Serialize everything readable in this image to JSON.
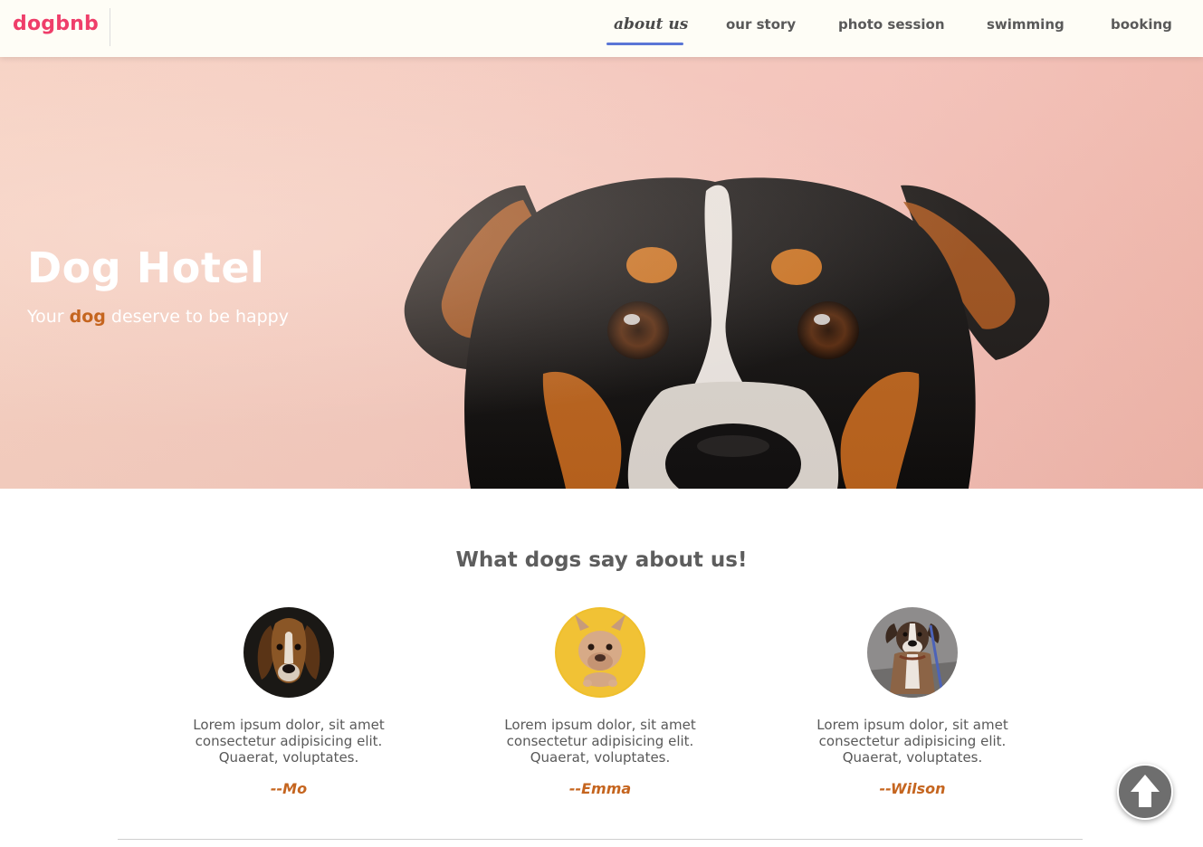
{
  "header": {
    "logo": "dogbnb",
    "nav": [
      {
        "label": "about us",
        "active": true
      },
      {
        "label": "our story",
        "active": false
      },
      {
        "label": "photo session",
        "active": false
      },
      {
        "label": "swimming",
        "active": false
      },
      {
        "label": "booking",
        "active": false
      }
    ]
  },
  "hero": {
    "title": "Dog Hotel",
    "subtitle_before": "Your ",
    "subtitle_accent": "dog",
    "subtitle_after": " deserve to be happy"
  },
  "testimonials": {
    "heading": "What dogs say about us!",
    "items": [
      {
        "quote": "Lorem ipsum dolor, sit amet consectetur adipisicing elit. Quaerat, voluptates.",
        "author": "--Mo",
        "avatar": "beagle-photo"
      },
      {
        "quote": "Lorem ipsum dolor, sit amet consectetur adipisicing elit. Quaerat, voluptates.",
        "author": "--Emma",
        "avatar": "french-bulldog-photo"
      },
      {
        "quote": "Lorem ipsum dolor, sit amet consectetur adipisicing elit. Quaerat, voluptates.",
        "author": "--Wilson",
        "avatar": "boxer-photo"
      }
    ]
  },
  "back_to_top": {
    "icon": "arrow-up-icon"
  },
  "colors": {
    "brand": "#ef3e6a",
    "accent": "#c5651f",
    "nav_underline": "#5a76d6",
    "text": "#595959"
  }
}
